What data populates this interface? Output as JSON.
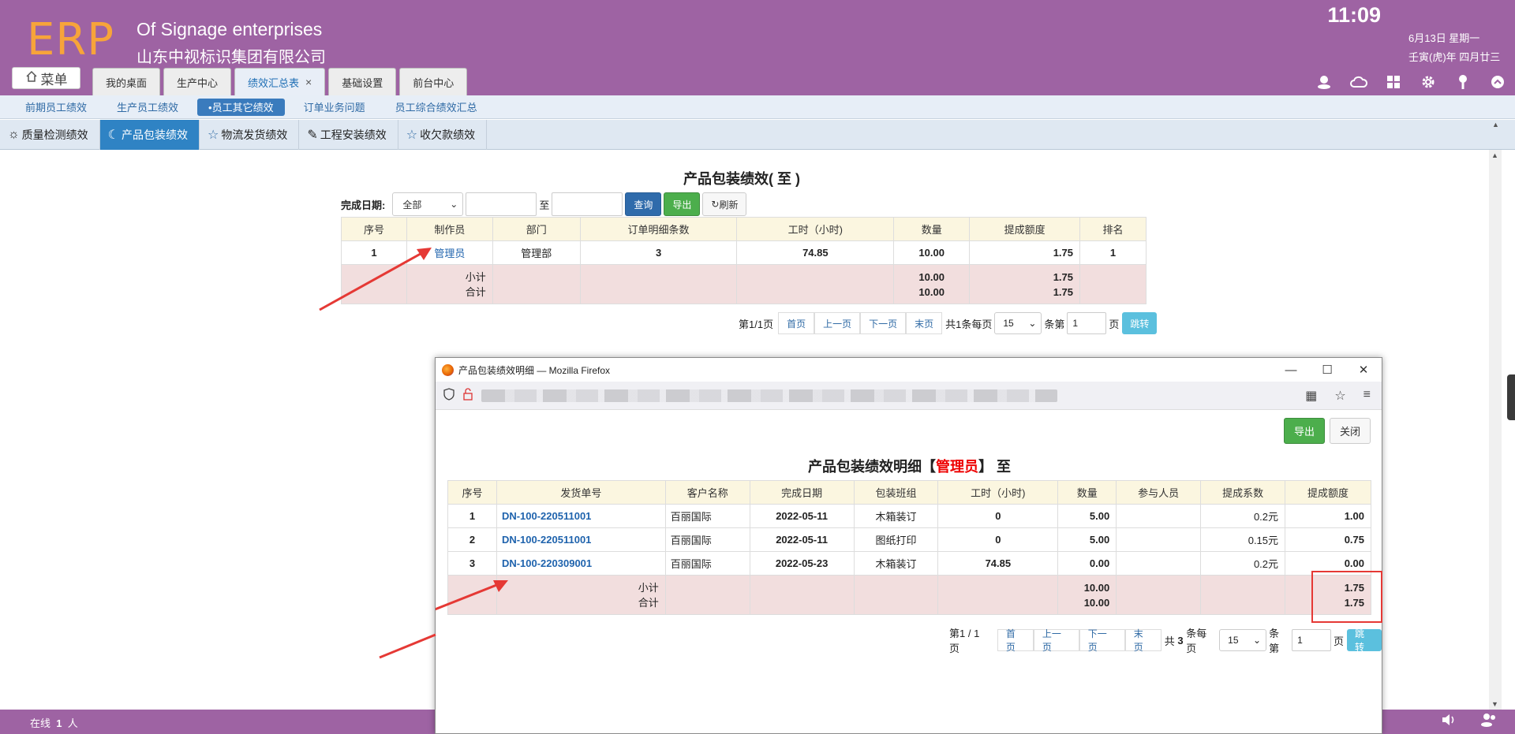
{
  "header": {
    "logo": "ERP",
    "company_en": "Of Signage enterprises",
    "company_cn": "山东中视标识集团有限公司",
    "time": "11:09",
    "date_line1": "6月13日 星期一",
    "date_line2": "壬寅(虎)年 四月廿三",
    "menu_label": "菜单",
    "tabs": [
      {
        "label": "我的桌面"
      },
      {
        "label": "生产中心"
      },
      {
        "label": "绩效汇总表"
      },
      {
        "label": "基础设置"
      },
      {
        "label": "前台中心"
      }
    ]
  },
  "subnav": {
    "items": [
      {
        "label": "前期员工绩效"
      },
      {
        "label": "生产员工绩效"
      },
      {
        "label": "•员工其它绩效"
      },
      {
        "label": "订单业务问题"
      },
      {
        "label": "员工综合绩效汇总"
      }
    ]
  },
  "subtabs": [
    {
      "icon": "☼",
      "label": "质量检测绩效"
    },
    {
      "icon": "☾",
      "label": "产品包装绩效"
    },
    {
      "icon": "☆",
      "label": "物流发货绩效"
    },
    {
      "icon": "✎",
      "label": "工程安装绩效"
    },
    {
      "icon": "☆",
      "label": "收欠款绩效"
    }
  ],
  "main": {
    "title": "产品包装绩效( 至 )",
    "filter": {
      "label": "完成日期:",
      "select_value": "全部",
      "to_label": "至",
      "query": "查询",
      "export": "导出",
      "refresh": "刷新"
    },
    "table": {
      "headers": [
        "序号",
        "制作员",
        "部门",
        "订单明细条数",
        "工时（小时)",
        "数量",
        "提成额度",
        "排名"
      ],
      "rows": [
        {
          "no": "1",
          "maker": "管理员",
          "dept": "管理部",
          "lines": "3",
          "hours": "74.85",
          "qty": "10.00",
          "commission": "1.75",
          "rank": "1"
        }
      ],
      "subtotal_label": "小计",
      "total_label": "合计",
      "subtotal_qty": "10.00",
      "subtotal_commission": "1.75",
      "total_qty": "10.00",
      "total_commission": "1.75"
    },
    "pager": {
      "page_info": "第1/1页",
      "first": "首页",
      "prev": "上一页",
      "next": "下一页",
      "last": "末页",
      "total_text": "共1条每页",
      "per_page": "15",
      "goto_label": "条第",
      "page_value": "1",
      "page_suffix": "页",
      "go": "跳转"
    }
  },
  "popup": {
    "window_title": "产品包装绩效明细 — Mozilla Firefox",
    "export": "导出",
    "close": "关闭",
    "title_prefix": "产品包装绩效明细【",
    "title_name": "管理员",
    "title_suffix": "】 至",
    "table": {
      "headers": [
        "序号",
        "发货单号",
        "客户名称",
        "完成日期",
        "包装班组",
        "工时（小时)",
        "数量",
        "参与人员",
        "提成系数",
        "提成额度"
      ],
      "rows": [
        {
          "no": "1",
          "ship_no": "DN-100-220511001",
          "customer": "百丽国际",
          "date": "2022-05-11",
          "team": "木箱装订",
          "hours": "0",
          "qty": "5.00",
          "people": "",
          "coef": "0.2元",
          "commission": "1.00"
        },
        {
          "no": "2",
          "ship_no": "DN-100-220511001",
          "customer": "百丽国际",
          "date": "2022-05-11",
          "team": "图纸打印",
          "hours": "0",
          "qty": "5.00",
          "people": "",
          "coef": "0.15元",
          "commission": "0.75"
        },
        {
          "no": "3",
          "ship_no": "DN-100-220309001",
          "customer": "百丽国际",
          "date": "2022-05-23",
          "team": "木箱装订",
          "hours": "74.85",
          "qty": "0.00",
          "people": "",
          "coef": "0.2元",
          "commission": "0.00"
        }
      ],
      "subtotal_label": "小计",
      "total_label": "合计",
      "subtotal_qty": "10.00",
      "subtotal_commission": "1.75",
      "total_qty": "10.00",
      "total_commission": "1.75"
    },
    "pager": {
      "page_info": "第1 / 1 页",
      "first": "首页",
      "prev": "上一页",
      "next": "下一页",
      "last": "末页",
      "total_prefix": "共",
      "total_count": "3",
      "total_text": "条每页",
      "per_page": "15",
      "goto_label": "条第",
      "page_value": "1",
      "page_suffix": "页",
      "go": "跳转"
    }
  },
  "footer": {
    "online_prefix": "在线",
    "online_count": "1",
    "online_suffix": "人"
  },
  "colors": {
    "header_bg": "#9e63a3",
    "logo": "#f7a43a",
    "active_tab": "#2f83c4",
    "annotation_red": "#e53935"
  }
}
